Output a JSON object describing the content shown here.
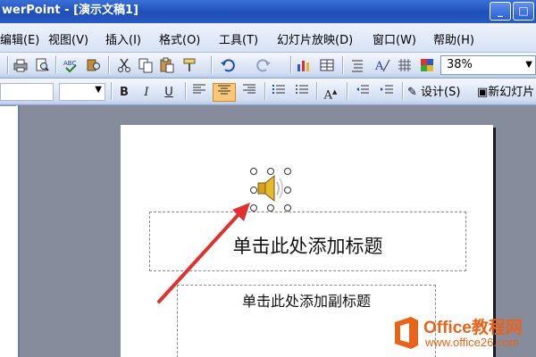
{
  "window": {
    "title": "werPoint - [演示文稿1]",
    "minimize_glyph": "_",
    "maximize_glyph": "□"
  },
  "menu": {
    "items": [
      {
        "label": "编辑(E)"
      },
      {
        "label": "视图(V)"
      },
      {
        "label": "插入(I)"
      },
      {
        "label": "格式(O)"
      },
      {
        "label": "工具(T)"
      },
      {
        "label": "幻灯片放映(D)"
      },
      {
        "label": "窗口(W)"
      },
      {
        "label": "帮助(H)"
      }
    ]
  },
  "toolbar": {
    "zoom_value": "38%",
    "zoom_dropdown_glyph": "▼",
    "icons": [
      "print-icon",
      "print-preview-icon",
      "spelling-icon",
      "research-icon",
      "cut-icon",
      "copy-icon",
      "paste-icon",
      "format-painter-icon",
      "undo-icon",
      "redo-icon",
      "insert-chart-icon",
      "insert-table-icon",
      "expand-all-icon",
      "show-formatting-icon",
      "show-grid-icon",
      "color-grayscale-icon"
    ]
  },
  "formatting": {
    "bold_label": "B",
    "italic_label": "I",
    "underline_label": "U",
    "font_size_up_label": "A",
    "design_label": "设计(S)",
    "new_slide_label": "新幻灯片"
  },
  "slide": {
    "title_placeholder": "单击此处添加标题",
    "subtitle_placeholder": "单击此处添加副标题"
  },
  "watermark": {
    "line1": "Office教程网",
    "line2": "www.office26.com",
    "brand_color": "#e8641b"
  }
}
